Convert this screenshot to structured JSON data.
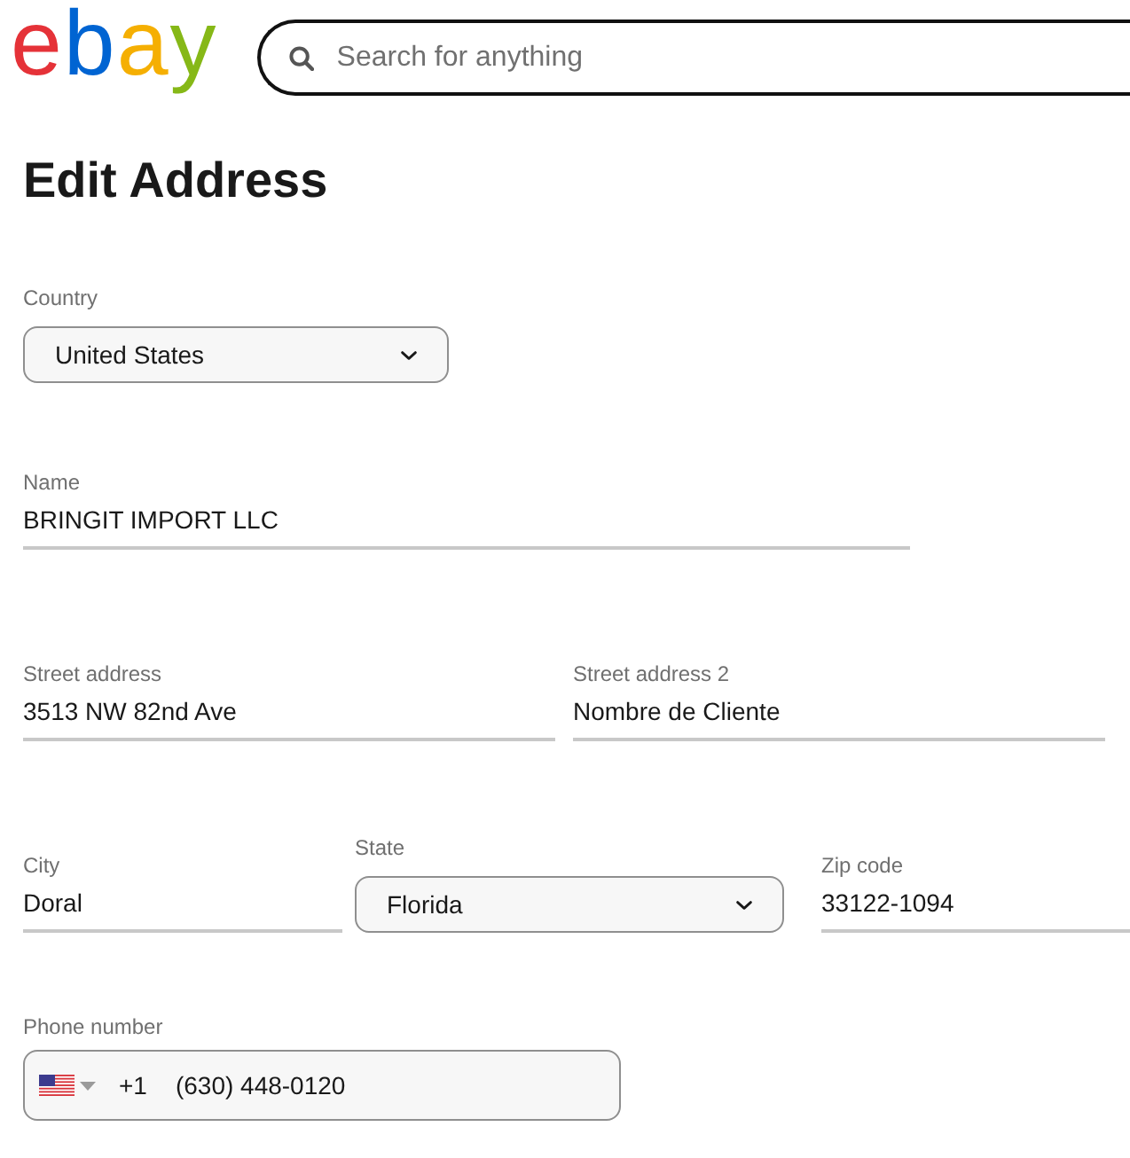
{
  "header": {
    "logo": "ebay",
    "search": {
      "placeholder": "Search for anything"
    }
  },
  "page": {
    "title": "Edit Address"
  },
  "form": {
    "rows": [
      [
        {
          "kind": "select",
          "label": "Country",
          "value": "United States"
        }
      ],
      [
        {
          "kind": "text",
          "label": "Name",
          "value": "BRINGIT IMPORT LLC"
        }
      ],
      [
        {
          "kind": "text",
          "label": "Street address",
          "value": "3513 NW 82nd Ave"
        },
        {
          "kind": "text",
          "label": "Street address 2",
          "value": "Nombre de Cliente"
        }
      ],
      [
        {
          "kind": "text",
          "label": "City",
          "value": "Doral"
        },
        {
          "kind": "select",
          "label": "State",
          "value": "Florida"
        },
        {
          "kind": "text",
          "label": "Zip code",
          "value": "33122-1094"
        }
      ],
      [
        {
          "kind": "phone",
          "label": "Phone number",
          "country_code": "+1",
          "value": "(630) 448-0120"
        }
      ]
    ]
  }
}
